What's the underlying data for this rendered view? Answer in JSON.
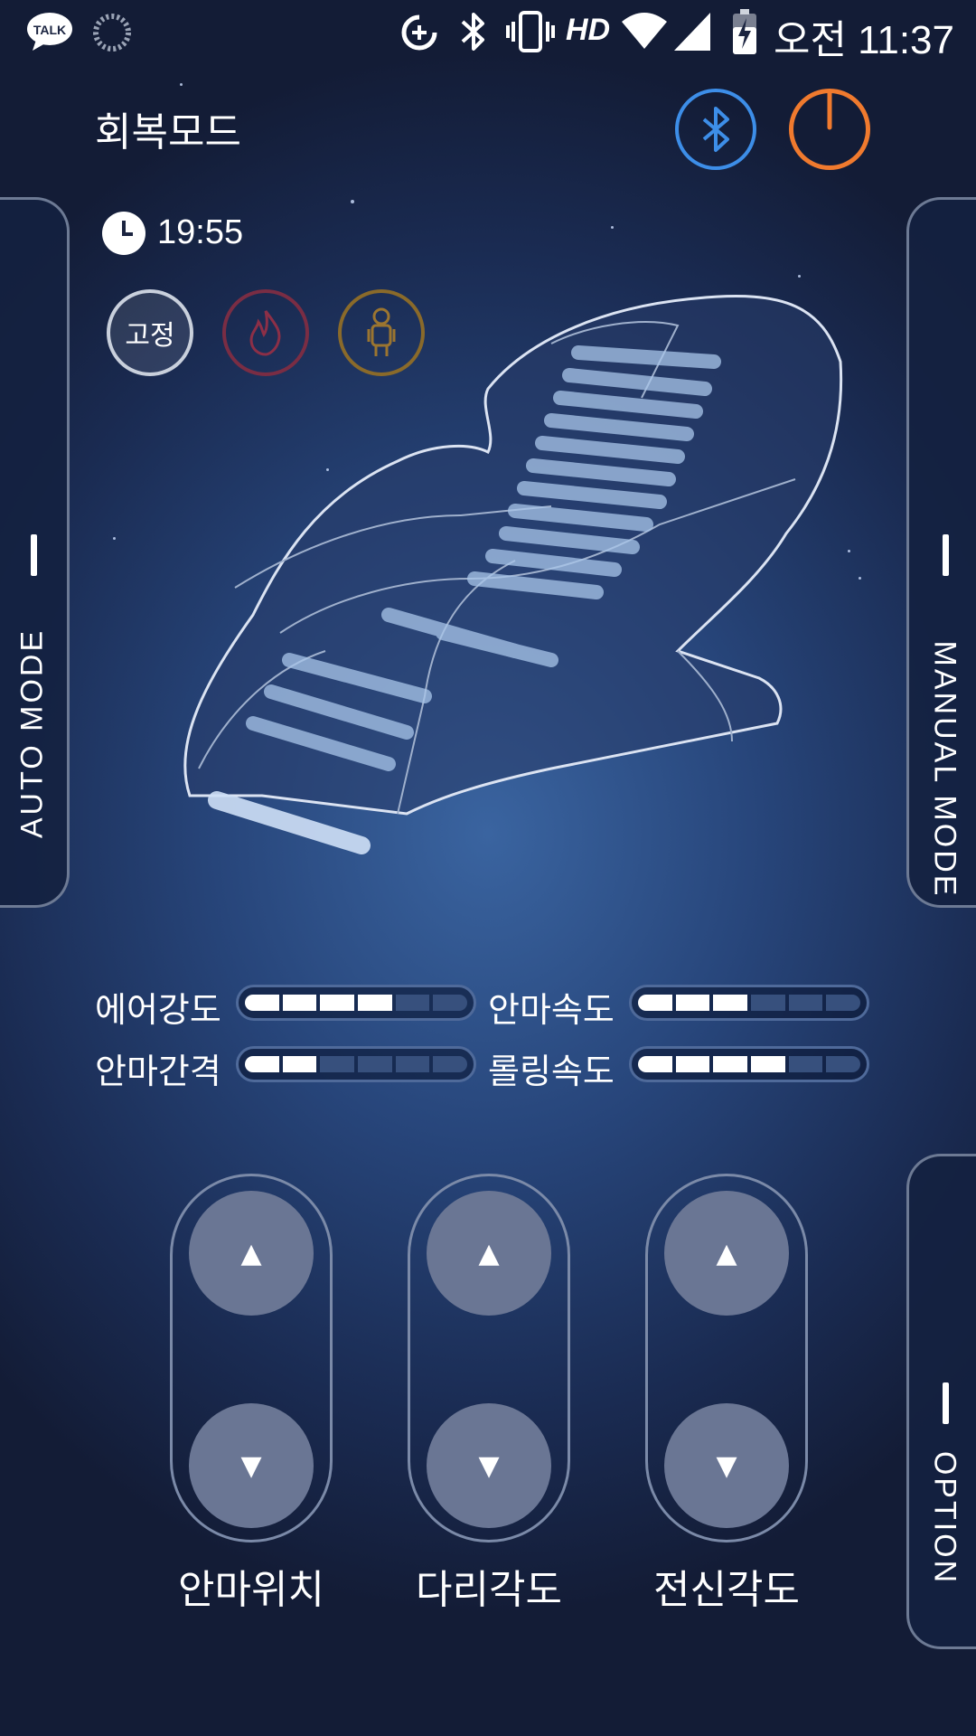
{
  "status_bar": {
    "talk_label": "TALK",
    "network_label": "HD",
    "time": "오전 11:37"
  },
  "header": {
    "title": "회복모드",
    "bluetooth_color": "#3d8ee8",
    "power_color": "#f07a2e"
  },
  "tabs": {
    "left": "AUTO MODE",
    "right": "MANUAL MODE",
    "option": "OPTION"
  },
  "timer": {
    "value": "19:55"
  },
  "quick_buttons": {
    "fix": "고정",
    "heat_icon": "flame-icon",
    "body_icon": "body-scan-icon"
  },
  "levels": [
    {
      "label": "에어강도",
      "value": 4,
      "max": 6
    },
    {
      "label": "안마속도",
      "value": 3,
      "max": 6
    },
    {
      "label": "안마간격",
      "value": 2,
      "max": 6
    },
    {
      "label": "롤링속도",
      "value": 4,
      "max": 6
    }
  ],
  "adjusters": [
    {
      "label": "안마위치"
    },
    {
      "label": "다리각도"
    },
    {
      "label": "전신각도"
    }
  ]
}
